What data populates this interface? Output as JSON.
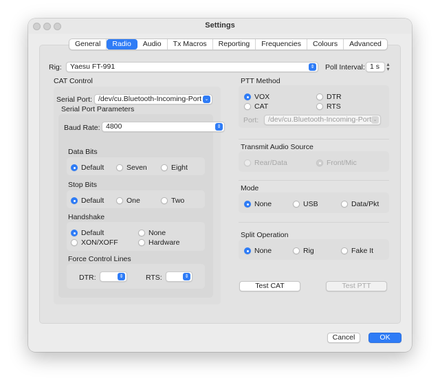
{
  "window": {
    "title": "Settings"
  },
  "tabs": [
    "General",
    "Radio",
    "Audio",
    "Tx Macros",
    "Reporting",
    "Frequencies",
    "Colours",
    "Advanced"
  ],
  "rig": {
    "label": "Rig:",
    "value": "Yaesu FT-991"
  },
  "poll_interval": {
    "label": "Poll Interval:",
    "value": "1 s"
  },
  "cat_control": {
    "title": "CAT Control",
    "serial_port_label": "Serial Port:",
    "serial_port_value": "/dev/cu.Bluetooth-Incoming-Port",
    "params_title": "Serial Port Parameters",
    "baud_rate_label": "Baud Rate:",
    "baud_rate_value": "4800",
    "data_bits": {
      "title": "Data Bits",
      "options": [
        "Default",
        "Seven",
        "Eight"
      ]
    },
    "stop_bits": {
      "title": "Stop Bits",
      "options": [
        "Default",
        "One",
        "Two"
      ]
    },
    "handshake": {
      "title": "Handshake",
      "options": [
        "Default",
        "None",
        "XON/XOFF",
        "Hardware"
      ]
    },
    "force_lines": {
      "title": "Force Control Lines",
      "dtr_label": "DTR:",
      "rts_label": "RTS:"
    }
  },
  "ptt": {
    "title": "PTT Method",
    "options": [
      "VOX",
      "DTR",
      "CAT",
      "RTS"
    ],
    "port_label": "Port:",
    "port_value": "/dev/cu.Bluetooth-Incoming-Port"
  },
  "tx_audio": {
    "title": "Transmit Audio Source",
    "options": [
      "Rear/Data",
      "Front/Mic"
    ]
  },
  "mode": {
    "title": "Mode",
    "options": [
      "None",
      "USB",
      "Data/Pkt"
    ]
  },
  "split": {
    "title": "Split Operation",
    "options": [
      "None",
      "Rig",
      "Fake It"
    ]
  },
  "buttons": {
    "test_cat": "Test CAT",
    "test_ptt": "Test PTT",
    "cancel": "Cancel",
    "ok": "OK"
  },
  "colors": {
    "accent": "#2f7cf6"
  },
  "icons": {
    "popup": "updown-chevron-icon",
    "stepper": "stepper-arrows-icon"
  }
}
